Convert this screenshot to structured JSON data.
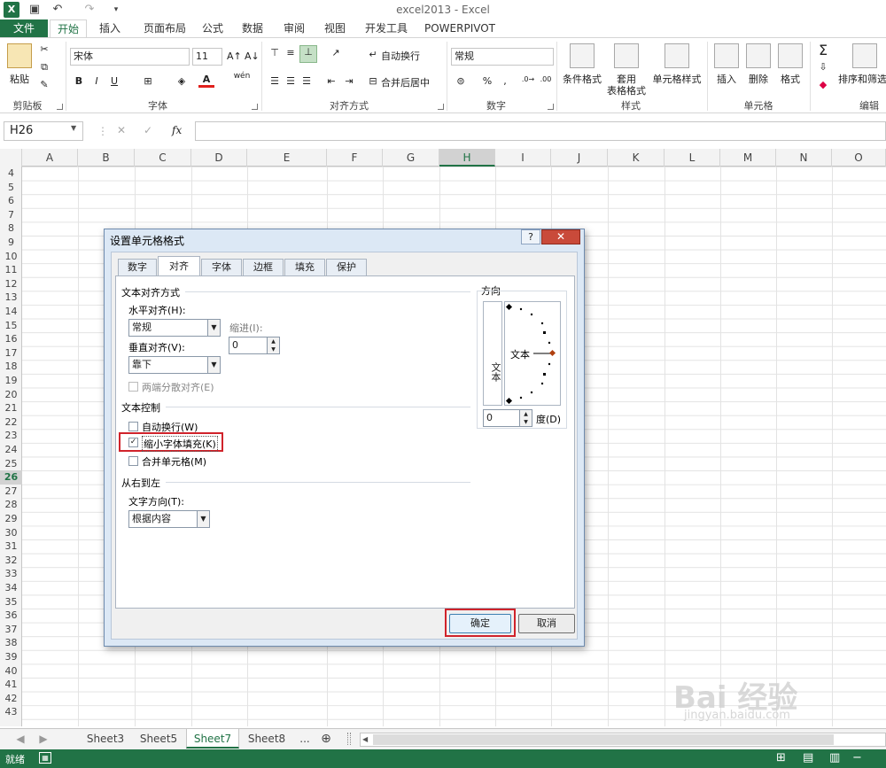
{
  "app": {
    "window_title": "excel2013 - Excel",
    "status": "就绪"
  },
  "tabs": [
    "文件",
    "开始",
    "插入",
    "页面布局",
    "公式",
    "数据",
    "审阅",
    "视图",
    "开发工具",
    "POWERPIVOT"
  ],
  "ribbon": {
    "clipboard": {
      "paste": "粘贴",
      "group": "剪贴板"
    },
    "font": {
      "name": "宋体",
      "size": "11",
      "group": "字体",
      "bold": "B",
      "italic": "I",
      "underline": "U",
      "phonetic": "wén"
    },
    "align": {
      "wrap": "自动换行",
      "merge": "合并后居中",
      "group": "对齐方式"
    },
    "number": {
      "format": "常规",
      "group": "数字",
      "percent": "%",
      "comma": ","
    },
    "styles": {
      "cond": "条件格式",
      "table1": "套用",
      "table2": "表格格式",
      "cell": "单元格样式",
      "group": "样式"
    },
    "cells": {
      "insert": "插入",
      "delete": "删除",
      "format": "格式",
      "group": "单元格"
    },
    "edit": {
      "sort": "排序和筛选",
      "group": "编辑",
      "sum": "Σ"
    }
  },
  "formula_bar": {
    "name_box": "H26",
    "fx": "fx",
    "cancel": "✕",
    "enter": "✓"
  },
  "columns": [
    "A",
    "B",
    "C",
    "D",
    "E",
    "F",
    "G",
    "H",
    "I",
    "J",
    "K",
    "L",
    "M",
    "N",
    "O"
  ],
  "rows": [
    "4",
    "5",
    "6",
    "7",
    "8",
    "9",
    "10",
    "11",
    "12",
    "13",
    "14",
    "15",
    "16",
    "17",
    "18",
    "19",
    "20",
    "21",
    "22",
    "23",
    "24",
    "25",
    "26",
    "27",
    "28",
    "29",
    "30",
    "31",
    "32",
    "33",
    "34",
    "35",
    "36",
    "37",
    "38",
    "39",
    "40",
    "41",
    "42",
    "43"
  ],
  "selected": {
    "column": "H",
    "row": "26"
  },
  "sheets": {
    "left": "◀",
    "right": "▶",
    "tabs": [
      "Sheet3",
      "Sheet5",
      "Sheet7",
      "Sheet8"
    ],
    "active": "Sheet7",
    "more": "...",
    "add": "⊕"
  },
  "dialog": {
    "title": "设置单元格格式",
    "help": "?",
    "close": "✕",
    "tabs": [
      "数字",
      "对齐",
      "字体",
      "边框",
      "填充",
      "保护"
    ],
    "active_tab": "对齐",
    "text_align_group": "文本对齐方式",
    "horizontal_label": "水平对齐(H):",
    "horizontal_value": "常规",
    "indent_label": "缩进(I):",
    "indent_value": "0",
    "vertical_label": "垂直对齐(V):",
    "vertical_value": "靠下",
    "justify_distributed": "两端分散对齐(E)",
    "text_control_group": "文本控制",
    "wrap_text": "自动换行(W)",
    "shrink_to_fit": "缩小字体填充(K)",
    "shrink_checked": true,
    "merge_cells": "合并单元格(M)",
    "rtl_group": "从右到左",
    "text_direction_label": "文字方向(T):",
    "text_direction_value": "根据内容",
    "orientation_group": "方向",
    "vertical_text": "文本",
    "horizontal_text": "文本",
    "degrees_value": "0",
    "degrees_label": "度(D)",
    "ok": "确定",
    "cancel": "取消"
  },
  "watermark": {
    "brand": "Bai 经验",
    "url": "jingyan.baidu.com"
  }
}
